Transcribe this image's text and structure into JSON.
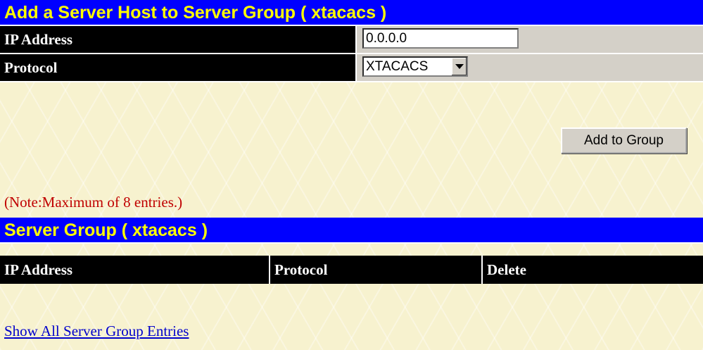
{
  "add_section": {
    "title": "Add a Server Host to Server Group ( xtacacs )",
    "ip_label": "IP Address",
    "ip_value": "0.0.0.0",
    "protocol_label": "Protocol",
    "protocol_value": "XTACACS",
    "add_button": "Add to Group",
    "note": "(Note:Maximum of 8 entries.)"
  },
  "group_section": {
    "title": "Server Group ( xtacacs )",
    "columns": [
      "IP Address",
      "Protocol",
      "Delete"
    ],
    "rows": []
  },
  "show_all_link": "Show All Server Group Entries",
  "colors": {
    "title_bg": "#0000ff",
    "title_fg": "#ffff00",
    "header_bg": "#000000",
    "page_bg": "#f7f2cf",
    "note": "#c00000",
    "link": "#0000cc"
  }
}
